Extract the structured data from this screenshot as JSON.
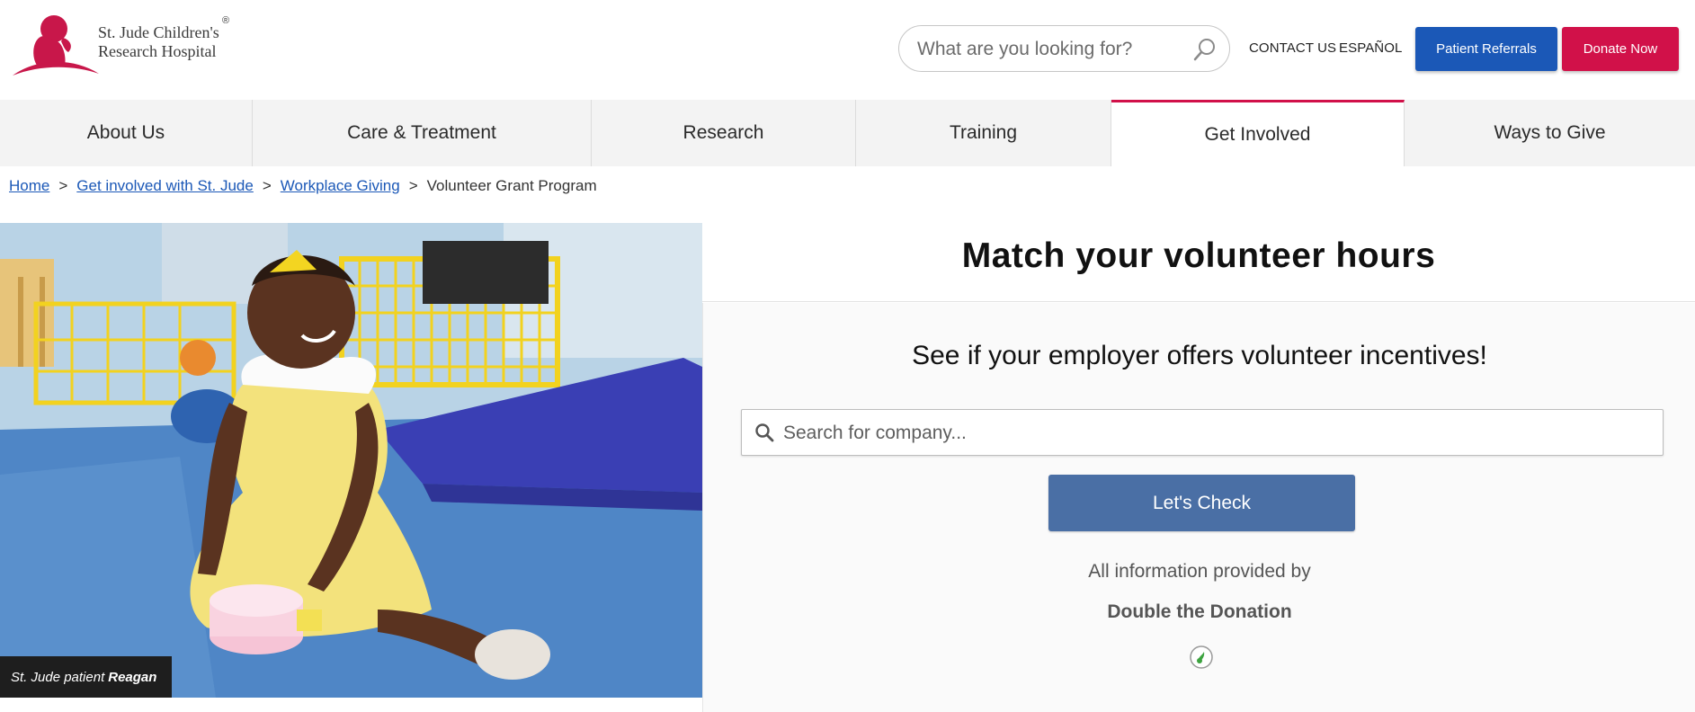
{
  "header": {
    "logo": {
      "line1": "St. Jude Children's",
      "line2": "Research Hospital",
      "registered": "®",
      "icon": "st-jude-child-logo-icon"
    },
    "search": {
      "placeholder": "What are you looking for?",
      "icon": "search-icon"
    },
    "contact_label": "CONTACT US",
    "espanol_label": "ESPAÑOL",
    "patient_referrals_label": "Patient Referrals",
    "donate_label": "Donate Now"
  },
  "nav": {
    "items": [
      {
        "label": "About Us",
        "active": false
      },
      {
        "label": "Care & Treatment",
        "active": false
      },
      {
        "label": "Research",
        "active": false
      },
      {
        "label": "Training",
        "active": false
      },
      {
        "label": "Get Involved",
        "active": true
      },
      {
        "label": "Ways to Give",
        "active": false
      }
    ],
    "accent_color": "#d11149"
  },
  "breadcrumb": {
    "home": "Home",
    "get_involved": "Get involved with St. Jude",
    "workplace_giving": "Workplace Giving",
    "current": "Volunteer Grant Program",
    "separator": ">"
  },
  "hero": {
    "caption_prefix": "St. Jude patient",
    "caption_name": "Reagan"
  },
  "matcher": {
    "title": "Match your volunteer hours",
    "subtitle": "See if your employer offers volunteer incentives!",
    "search_placeholder": "Search for company...",
    "search_icon": "search-icon",
    "check_label": "Let's Check",
    "info_text": "All information provided by",
    "brand": "Double the Donation",
    "brand_icon": "double-the-donation-logo-icon"
  },
  "colors": {
    "brand_blue": "#1b58b7",
    "brand_red": "#d11149",
    "check_button": "#4a6fa5"
  }
}
